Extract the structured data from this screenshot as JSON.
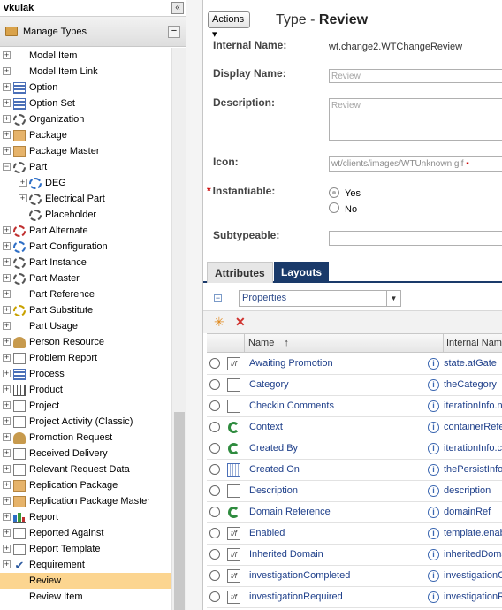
{
  "left_panel": {
    "user": "vkulak",
    "collapse_glyph": "«",
    "section_title": "Manage Types",
    "tree": [
      {
        "label": "Model Item",
        "icon": "blank",
        "level": 0,
        "expand": true
      },
      {
        "label": "Model Item Link",
        "icon": "blank",
        "level": 0,
        "expand": true
      },
      {
        "label": "Option",
        "icon": "list",
        "level": 0,
        "expand": true
      },
      {
        "label": "Option Set",
        "icon": "list",
        "level": 0,
        "expand": true
      },
      {
        "label": "Organization",
        "icon": "gear",
        "level": 0,
        "expand": true
      },
      {
        "label": "Package",
        "icon": "pkg",
        "level": 0,
        "expand": true
      },
      {
        "label": "Package Master",
        "icon": "pkg",
        "level": 0,
        "expand": true
      },
      {
        "label": "Part",
        "icon": "gear",
        "level": 0,
        "expand": true,
        "expanded": true
      },
      {
        "label": "DEG",
        "icon": "gear-blue",
        "level": 1,
        "expand": true
      },
      {
        "label": "Electrical Part",
        "icon": "gear",
        "level": 1,
        "expand": true
      },
      {
        "label": "Placeholder",
        "icon": "gear",
        "level": 1,
        "expand": false
      },
      {
        "label": "Part Alternate",
        "icon": "gear-red",
        "level": 0,
        "expand": true
      },
      {
        "label": "Part Configuration",
        "icon": "gear-blue",
        "level": 0,
        "expand": true
      },
      {
        "label": "Part Instance",
        "icon": "gear",
        "level": 0,
        "expand": true
      },
      {
        "label": "Part Master",
        "icon": "gear",
        "level": 0,
        "expand": true
      },
      {
        "label": "Part Reference",
        "icon": "blank",
        "level": 0,
        "expand": true
      },
      {
        "label": "Part Substitute",
        "icon": "gear-yellow",
        "level": 0,
        "expand": true
      },
      {
        "label": "Part Usage",
        "icon": "blank",
        "level": 0,
        "expand": true
      },
      {
        "label": "Person Resource",
        "icon": "person",
        "level": 0,
        "expand": true
      },
      {
        "label": "Problem Report",
        "icon": "doc",
        "level": 0,
        "expand": true
      },
      {
        "label": "Process",
        "icon": "list",
        "level": 0,
        "expand": true
      },
      {
        "label": "Product",
        "icon": "grid",
        "level": 0,
        "expand": true
      },
      {
        "label": "Project",
        "icon": "doc",
        "level": 0,
        "expand": true
      },
      {
        "label": "Project Activity (Classic)",
        "icon": "doc",
        "level": 0,
        "expand": true
      },
      {
        "label": "Promotion Request",
        "icon": "person",
        "level": 0,
        "expand": true
      },
      {
        "label": "Received Delivery",
        "icon": "doc",
        "level": 0,
        "expand": true
      },
      {
        "label": "Relevant Request Data",
        "icon": "doc",
        "level": 0,
        "expand": true
      },
      {
        "label": "Replication Package",
        "icon": "pkg",
        "level": 0,
        "expand": true
      },
      {
        "label": "Replication Package Master",
        "icon": "pkg",
        "level": 0,
        "expand": true
      },
      {
        "label": "Report",
        "icon": "bar",
        "level": 0,
        "expand": true
      },
      {
        "label": "Reported Against",
        "icon": "doc",
        "level": 0,
        "expand": true
      },
      {
        "label": "Report Template",
        "icon": "doc",
        "level": 0,
        "expand": true
      },
      {
        "label": "Requirement",
        "icon": "check",
        "level": 0,
        "expand": true
      },
      {
        "label": "Review",
        "icon": "blank",
        "level": 0,
        "expand": false,
        "selected": true
      },
      {
        "label": "Review Item",
        "icon": "blank",
        "level": 0,
        "expand": false
      }
    ]
  },
  "detail": {
    "actions_label": "Actions ▾",
    "title_prefix": "Type - ",
    "title_name": "Review",
    "internal_name_label": "Internal Name:",
    "internal_name_value": "wt.change2.WTChangeReview",
    "display_name_label": "Display Name:",
    "display_name_value": "Review",
    "description_label": "Description:",
    "description_value": "Review",
    "icon_label": "Icon:",
    "icon_value": "wt/clients/images/WTUnknown.gif",
    "instantiable_label": "Instantiable:",
    "required_mark": "*",
    "yes_label": "Yes",
    "no_label": "No",
    "subtypeable_label": "Subtypeable:",
    "subtypeable_value": "",
    "tabs": [
      "Attributes",
      "Layouts"
    ],
    "properties_select": "Properties",
    "table": {
      "col_name": "Name",
      "sort_indicator": "↑",
      "col_internal": "Internal Name",
      "rows": [
        {
          "name": "Awaiting Promotion",
          "icon": "fx",
          "internal": "state.atGate"
        },
        {
          "name": "Category",
          "icon": "doc",
          "internal": "theCategory"
        },
        {
          "name": "Checkin Comments",
          "icon": "doc",
          "internal": "iterationInfo.no"
        },
        {
          "name": "Context",
          "icon": "ref",
          "internal": "containerRefe"
        },
        {
          "name": "Created By",
          "icon": "ref",
          "internal": "iterationInfo.cr"
        },
        {
          "name": "Created On",
          "icon": "cal",
          "internal": "thePersistInfo"
        },
        {
          "name": "Description",
          "icon": "doc",
          "internal": "description"
        },
        {
          "name": "Domain Reference",
          "icon": "ref",
          "internal": "domainRef"
        },
        {
          "name": "Enabled",
          "icon": "fx",
          "internal": "template.enab"
        },
        {
          "name": "Inherited Domain",
          "icon": "fx",
          "internal": "inheritedDoma"
        },
        {
          "name": "investigationCompleted",
          "icon": "fx",
          "internal": "investigationC"
        },
        {
          "name": "investigationRequired",
          "icon": "fx",
          "internal": "investigationR"
        }
      ]
    }
  },
  "colors": {
    "selection": "#fcd590",
    "tab_active": "#1a3a6a",
    "link": "#1e3f8a"
  }
}
